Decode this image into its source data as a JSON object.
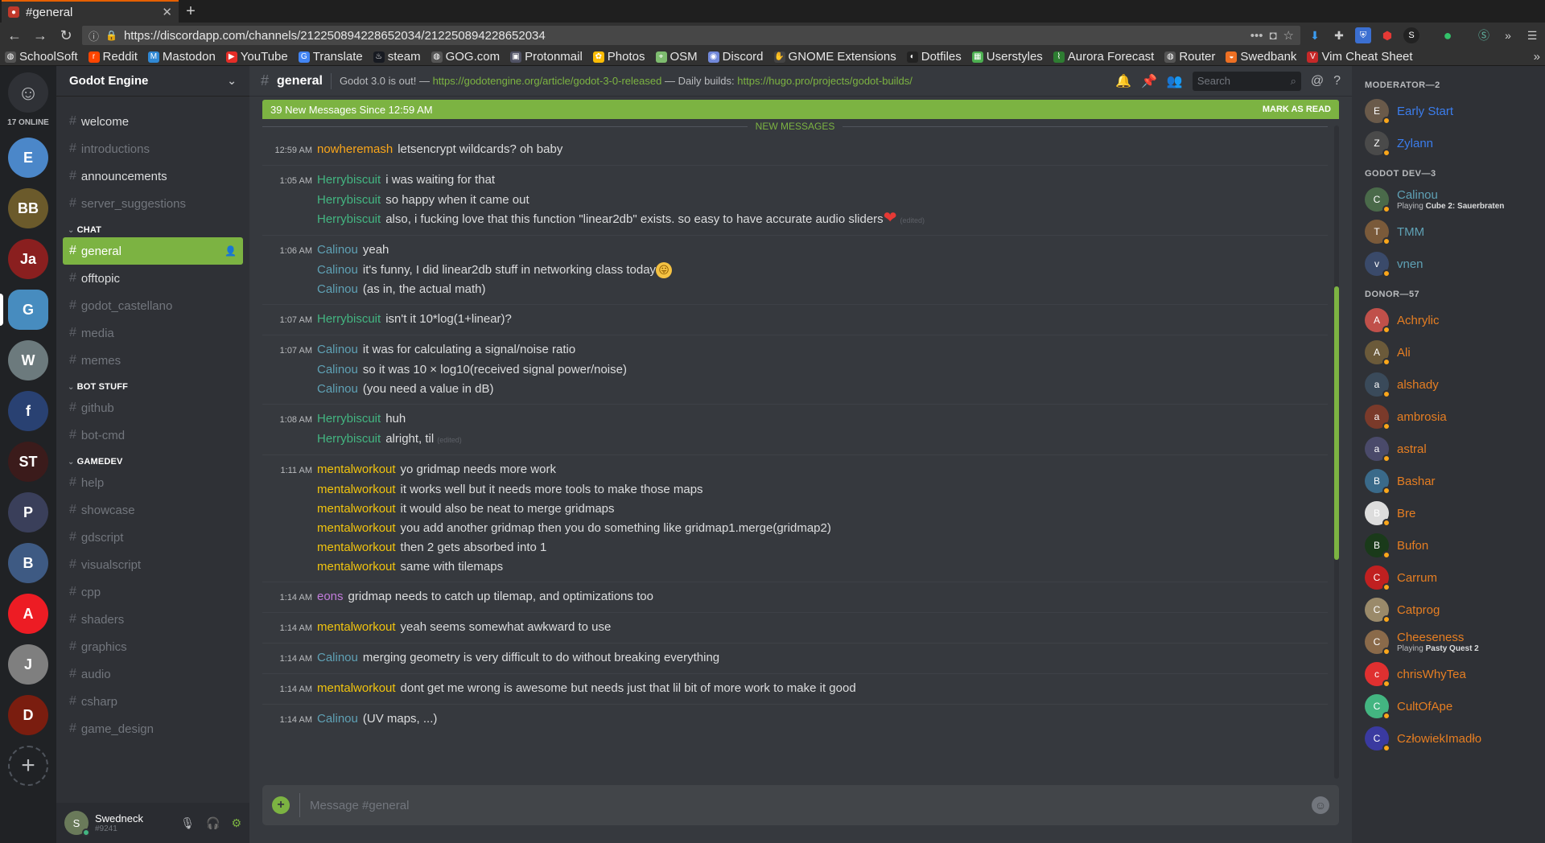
{
  "browser": {
    "tab_title": "#general",
    "url": "https://discordapp.com/channels/212250894228652034/212250894228652034",
    "bookmarks": [
      "SchoolSoft",
      "Reddit",
      "Mastodon",
      "YouTube",
      "Translate",
      "steam",
      "GOG.com",
      "Protonmail",
      "Photos",
      "OSM",
      "Discord",
      "GNOME Extensions",
      "Dotfiles",
      "Userstyles",
      "Aurora Forecast",
      "Router",
      "Swedbank",
      "Vim Cheat Sheet"
    ]
  },
  "guilds": {
    "online_label": "17 ONLINE",
    "items": [
      {
        "initial": "E",
        "color": "#4b87c9"
      },
      {
        "initial": "BB",
        "color": "#6b5a2b"
      },
      {
        "initial": "Ja",
        "color": "#8a1f1f"
      },
      {
        "initial": "G",
        "color": "#478cbf"
      },
      {
        "initial": "W",
        "color": "#6c7a7d"
      },
      {
        "initial": "f",
        "color": "#294172"
      },
      {
        "initial": "ST",
        "color": "#3b1b1b"
      },
      {
        "initial": "P",
        "color": "#3a3f5a"
      },
      {
        "initial": "B",
        "color": "#3e5a83"
      },
      {
        "initial": "A",
        "color": "#ed1c24"
      },
      {
        "initial": "J",
        "color": "#7f7f7f"
      },
      {
        "initial": "D",
        "color": "#7a1d0f"
      }
    ]
  },
  "server": {
    "name": "Godot Engine",
    "channels_top": [
      "welcome",
      "introductions",
      "announcements",
      "server_suggestions"
    ],
    "categories": [
      {
        "name": "CHAT",
        "channels": [
          "general",
          "offtopic",
          "godot_castellano",
          "media",
          "memes"
        ]
      },
      {
        "name": "BOT STUFF",
        "channels": [
          "github",
          "bot-cmd"
        ]
      },
      {
        "name": "GAMEDEV",
        "channels": [
          "help",
          "showcase",
          "gdscript",
          "visualscript",
          "cpp",
          "shaders",
          "graphics",
          "audio",
          "csharp",
          "game_design"
        ]
      }
    ]
  },
  "user": {
    "name": "Swedneck",
    "tag": "#9241"
  },
  "channel": {
    "name": "general",
    "topic_prefix": "Godot 3.0 is out! —",
    "topic_link1": "https://godotengine.org/article/godot-3-0-released",
    "topic_mid": "— Daily builds:",
    "topic_link2": "https://hugo.pro/projects/godot-builds/",
    "search_placeholder": "Search"
  },
  "newbar": {
    "text": "39 New Messages Since 12:59 AM",
    "mark": "MARK AS READ",
    "divider": "NEW MESSAGES"
  },
  "messages": [
    {
      "time": "12:59 AM",
      "author": "nowheremash",
      "color": "#faa61a",
      "lines": [
        "letsencrypt wildcards? oh baby"
      ]
    },
    {
      "time": "1:05 AM",
      "author": "Herrybiscuit",
      "color": "#43b581",
      "lines": [
        "i was waiting for that",
        "so happy when it came out",
        "also, i fucking love that this function \"linear2db\" exists. so easy to have accurate audio sliders"
      ]
    },
    {
      "time": "1:06 AM",
      "author": "Calinou",
      "color": "#5fa1b5",
      "lines": [
        "yeah",
        "it's funny, I did linear2db stuff in networking class today",
        "(as in, the actual math)"
      ]
    },
    {
      "time": "1:07 AM",
      "author": "Herrybiscuit",
      "color": "#43b581",
      "lines": [
        "isn't it 10*log(1+linear)?"
      ]
    },
    {
      "time": "1:07 AM",
      "author": "Calinou",
      "color": "#5fa1b5",
      "lines": [
        "it was for calculating a signal/noise ratio",
        "so it was 10 × log10(received signal power/noise)",
        "(you need a value in dB)"
      ]
    },
    {
      "time": "1:08 AM",
      "author": "Herrybiscuit",
      "color": "#43b581",
      "lines": [
        "huh",
        "alright, til"
      ]
    },
    {
      "time": "1:11 AM",
      "author": "mentalworkout",
      "color": "#f1c40f",
      "lines": [
        "yo gridmap needs more work",
        "it works well but it needs more tools to make those maps",
        "it would also be neat to merge gridmaps",
        "you add another gridmap then you do something like gridmap1.merge(gridmap2)",
        "then 2 gets absorbed into 1",
        "same with tilemaps"
      ]
    },
    {
      "time": "1:14 AM",
      "author": "eons",
      "color": "#c27cdb",
      "lines": [
        "gridmap needs to catch up tilemap, and optimizations too"
      ]
    },
    {
      "time": "1:14 AM",
      "author": "mentalworkout",
      "color": "#f1c40f",
      "lines": [
        "yeah seems somewhat awkward to use"
      ]
    },
    {
      "time": "1:14 AM",
      "author": "Calinou",
      "color": "#5fa1b5",
      "lines": [
        "merging geometry is very difficult to do without breaking everything"
      ]
    },
    {
      "time": "1:14 AM",
      "author": "mentalworkout",
      "color": "#f1c40f",
      "lines": [
        "dont get me wrong is awesome but needs just that lil bit of more work to make it good"
      ]
    },
    {
      "time": "1:14 AM",
      "author": "Calinou",
      "color": "#5fa1b5",
      "lines": [
        "(UV maps, ...)"
      ]
    }
  ],
  "edited_label": "(edited)",
  "composer": {
    "placeholder": "Message #general"
  },
  "members": [
    {
      "cat": "MODERATOR—2",
      "list": [
        {
          "name": "Early Start",
          "color": "#3b7ded",
          "av": "#6a5a4a"
        },
        {
          "name": "Zylann",
          "color": "#3b7ded",
          "av": "#4a4a4a"
        }
      ]
    },
    {
      "cat": "GODOT DEV—3",
      "list": [
        {
          "name": "Calinou",
          "color": "#5fa1b5",
          "av": "#4a6a4a",
          "game": "Cube 2: Sauerbraten"
        },
        {
          "name": "TMM",
          "color": "#5fa1b5",
          "av": "#7a5a3a"
        },
        {
          "name": "vnen",
          "color": "#5fa1b5",
          "av": "#3a4a6a"
        }
      ]
    },
    {
      "cat": "DONOR—57",
      "list": [
        {
          "name": "Achrylic",
          "color": "#e67e22",
          "av": "#c0504a"
        },
        {
          "name": "Ali",
          "color": "#e67e22",
          "av": "#6b5a3a"
        },
        {
          "name": "alshady",
          "color": "#e67e22",
          "av": "#3a4a5a"
        },
        {
          "name": "ambrosia",
          "color": "#e67e22",
          "av": "#7a3a2a"
        },
        {
          "name": "astral",
          "color": "#e67e22",
          "av": "#4a4a6a"
        },
        {
          "name": "Bashar",
          "color": "#e67e22",
          "av": "#3a6a8a"
        },
        {
          "name": "Bre",
          "color": "#e67e22",
          "av": "#ddd"
        },
        {
          "name": "Bufon",
          "color": "#e67e22",
          "av": "#1a3a1a"
        },
        {
          "name": "Carrum",
          "color": "#e67e22",
          "av": "#c02020"
        },
        {
          "name": "Catprog",
          "color": "#e67e22",
          "av": "#9a8a6a"
        },
        {
          "name": "Cheeseness",
          "color": "#e67e22",
          "av": "#8a6a4a",
          "game": "Pasty Quest 2"
        },
        {
          "name": "chrisWhyTea",
          "color": "#e67e22",
          "av": "#e03030"
        },
        {
          "name": "CultOfApe",
          "color": "#e67e22",
          "av": "#43b581"
        },
        {
          "name": "CzłowiekImadło",
          "color": "#e67e22",
          "av": "#3a3aa0"
        }
      ]
    }
  ],
  "labels": {
    "playing": "Playing"
  }
}
